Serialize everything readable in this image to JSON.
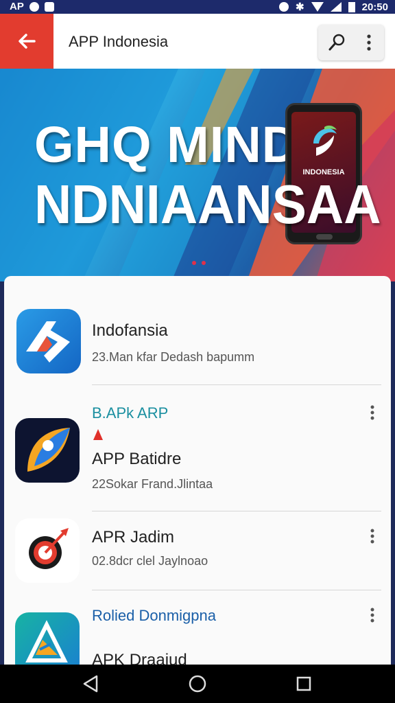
{
  "status_bar": {
    "carrier": "AP",
    "time": "20:50"
  },
  "app_bar": {
    "title": "APP Indonesia",
    "back_icon": "arrow-left-icon",
    "search_icon": "search-icon",
    "menu_icon": "more-vert-icon"
  },
  "banner": {
    "line1": "GHQ  MIND",
    "line2": "NDNIAANSAA",
    "phone_label": "INDONESIA",
    "colors": {
      "accent_red": "#e23c2f",
      "banner_blue": "#2aa6df"
    }
  },
  "list": {
    "items": [
      {
        "category": "",
        "title": "Indofansia",
        "subtitle": "23.Man kfar Dedash bapumm",
        "icon": "arrow-logo-icon"
      },
      {
        "category": "B.APk ARP",
        "title": "APP Batidre",
        "subtitle": "22Sokar Frand.Jlintaa",
        "icon": "feather-logo-icon"
      },
      {
        "category": "",
        "title": "APR Jadim",
        "subtitle": "02.8dcr clel Jaylnoao",
        "icon": "target-logo-icon"
      },
      {
        "category": "Rolied Donmigpna",
        "title": "APK Draaiud",
        "subtitle": "",
        "icon": "triangle-logo-icon"
      }
    ]
  },
  "nav": {
    "back": "back-triangle-icon",
    "home": "home-circle-icon",
    "recents": "recents-square-icon"
  }
}
